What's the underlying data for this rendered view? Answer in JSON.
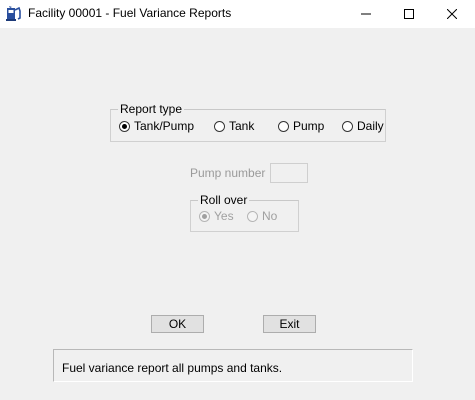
{
  "window": {
    "title": "Facility 00001 - Fuel Variance Reports",
    "icon": "fuel-pump-app-icon",
    "controls": [
      "minimize-icon",
      "maximize-icon",
      "close-icon"
    ]
  },
  "report_type": {
    "label": "Report type",
    "options": [
      {
        "label": "Tank/Pump",
        "selected": true
      },
      {
        "label": "Tank",
        "selected": false
      },
      {
        "label": "Pump",
        "selected": false
      },
      {
        "label": "Daily",
        "selected": false
      }
    ]
  },
  "pump_number": {
    "label": "Pump number",
    "value": "",
    "enabled": false
  },
  "roll_over": {
    "label": "Roll over",
    "enabled": false,
    "options": [
      {
        "label": "Yes",
        "selected": true
      },
      {
        "label": "No",
        "selected": false
      }
    ]
  },
  "buttons": {
    "ok_label": "OK",
    "exit_label": "Exit"
  },
  "status": {
    "text": "Fuel variance report all pumps and tanks."
  }
}
